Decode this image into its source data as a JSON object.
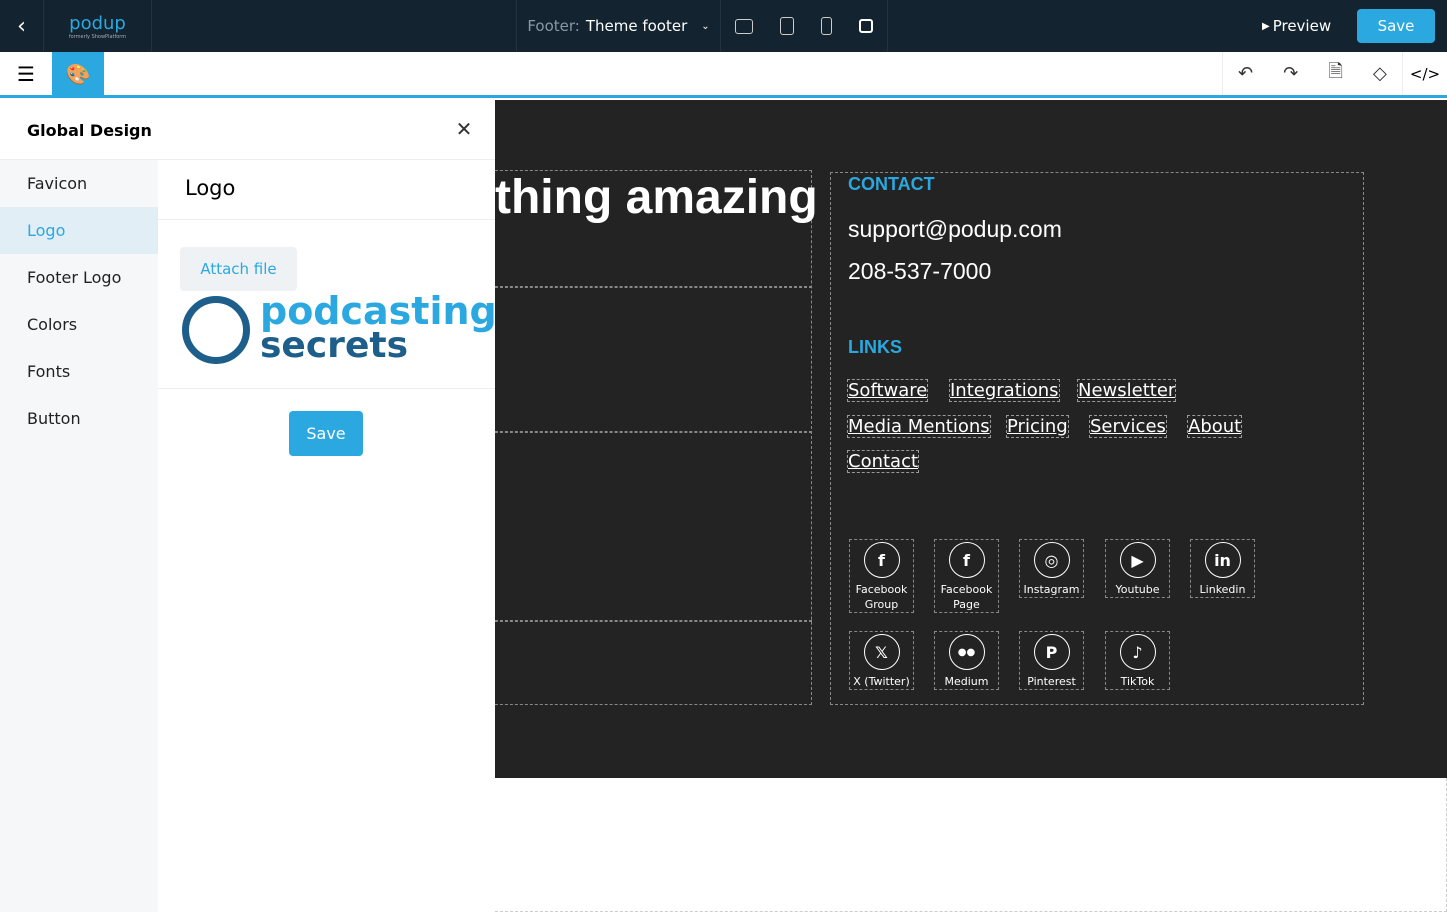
{
  "topbar": {
    "logo_text": "podup",
    "logo_sub": "formerly ShowPlatform",
    "footer_label": "Footer:",
    "footer_value": "Theme footer",
    "preview": "Preview",
    "save": "Save"
  },
  "panel": {
    "title": "Global Design",
    "nav": [
      "Favicon",
      "Logo",
      "Footer Logo",
      "Colors",
      "Fonts",
      "Button"
    ],
    "section_title": "Logo",
    "attach": "Attach file",
    "logo_line1": "podcasting",
    "logo_line2": "secrets",
    "save": "Save"
  },
  "canvas": {
    "heading": "thing amazing",
    "contact_title": "CONTACT",
    "email": "support@podup.com",
    "phone": "208-537-7000",
    "links_title": "LINKS",
    "links": [
      "Software",
      "Integrations",
      "Newsletter",
      "Media Mentions",
      "Pricing",
      "Services",
      "About",
      "Contact"
    ],
    "social": [
      {
        "label": "Facebook Group",
        "glyph": "f"
      },
      {
        "label": "Facebook Page",
        "glyph": "f"
      },
      {
        "label": "Instagram",
        "glyph": "◎"
      },
      {
        "label": "Youtube",
        "glyph": "▶"
      },
      {
        "label": "Linkedin",
        "glyph": "in"
      },
      {
        "label": "X (Twitter)",
        "glyph": "𝕏"
      },
      {
        "label": "Medium",
        "glyph": "●●"
      },
      {
        "label": "Pinterest",
        "glyph": "P"
      },
      {
        "label": "TikTok",
        "glyph": "♪"
      }
    ]
  },
  "colors": {
    "accent": "#2ba8e0",
    "topbar": "#13232f",
    "canvas": "#232323"
  }
}
